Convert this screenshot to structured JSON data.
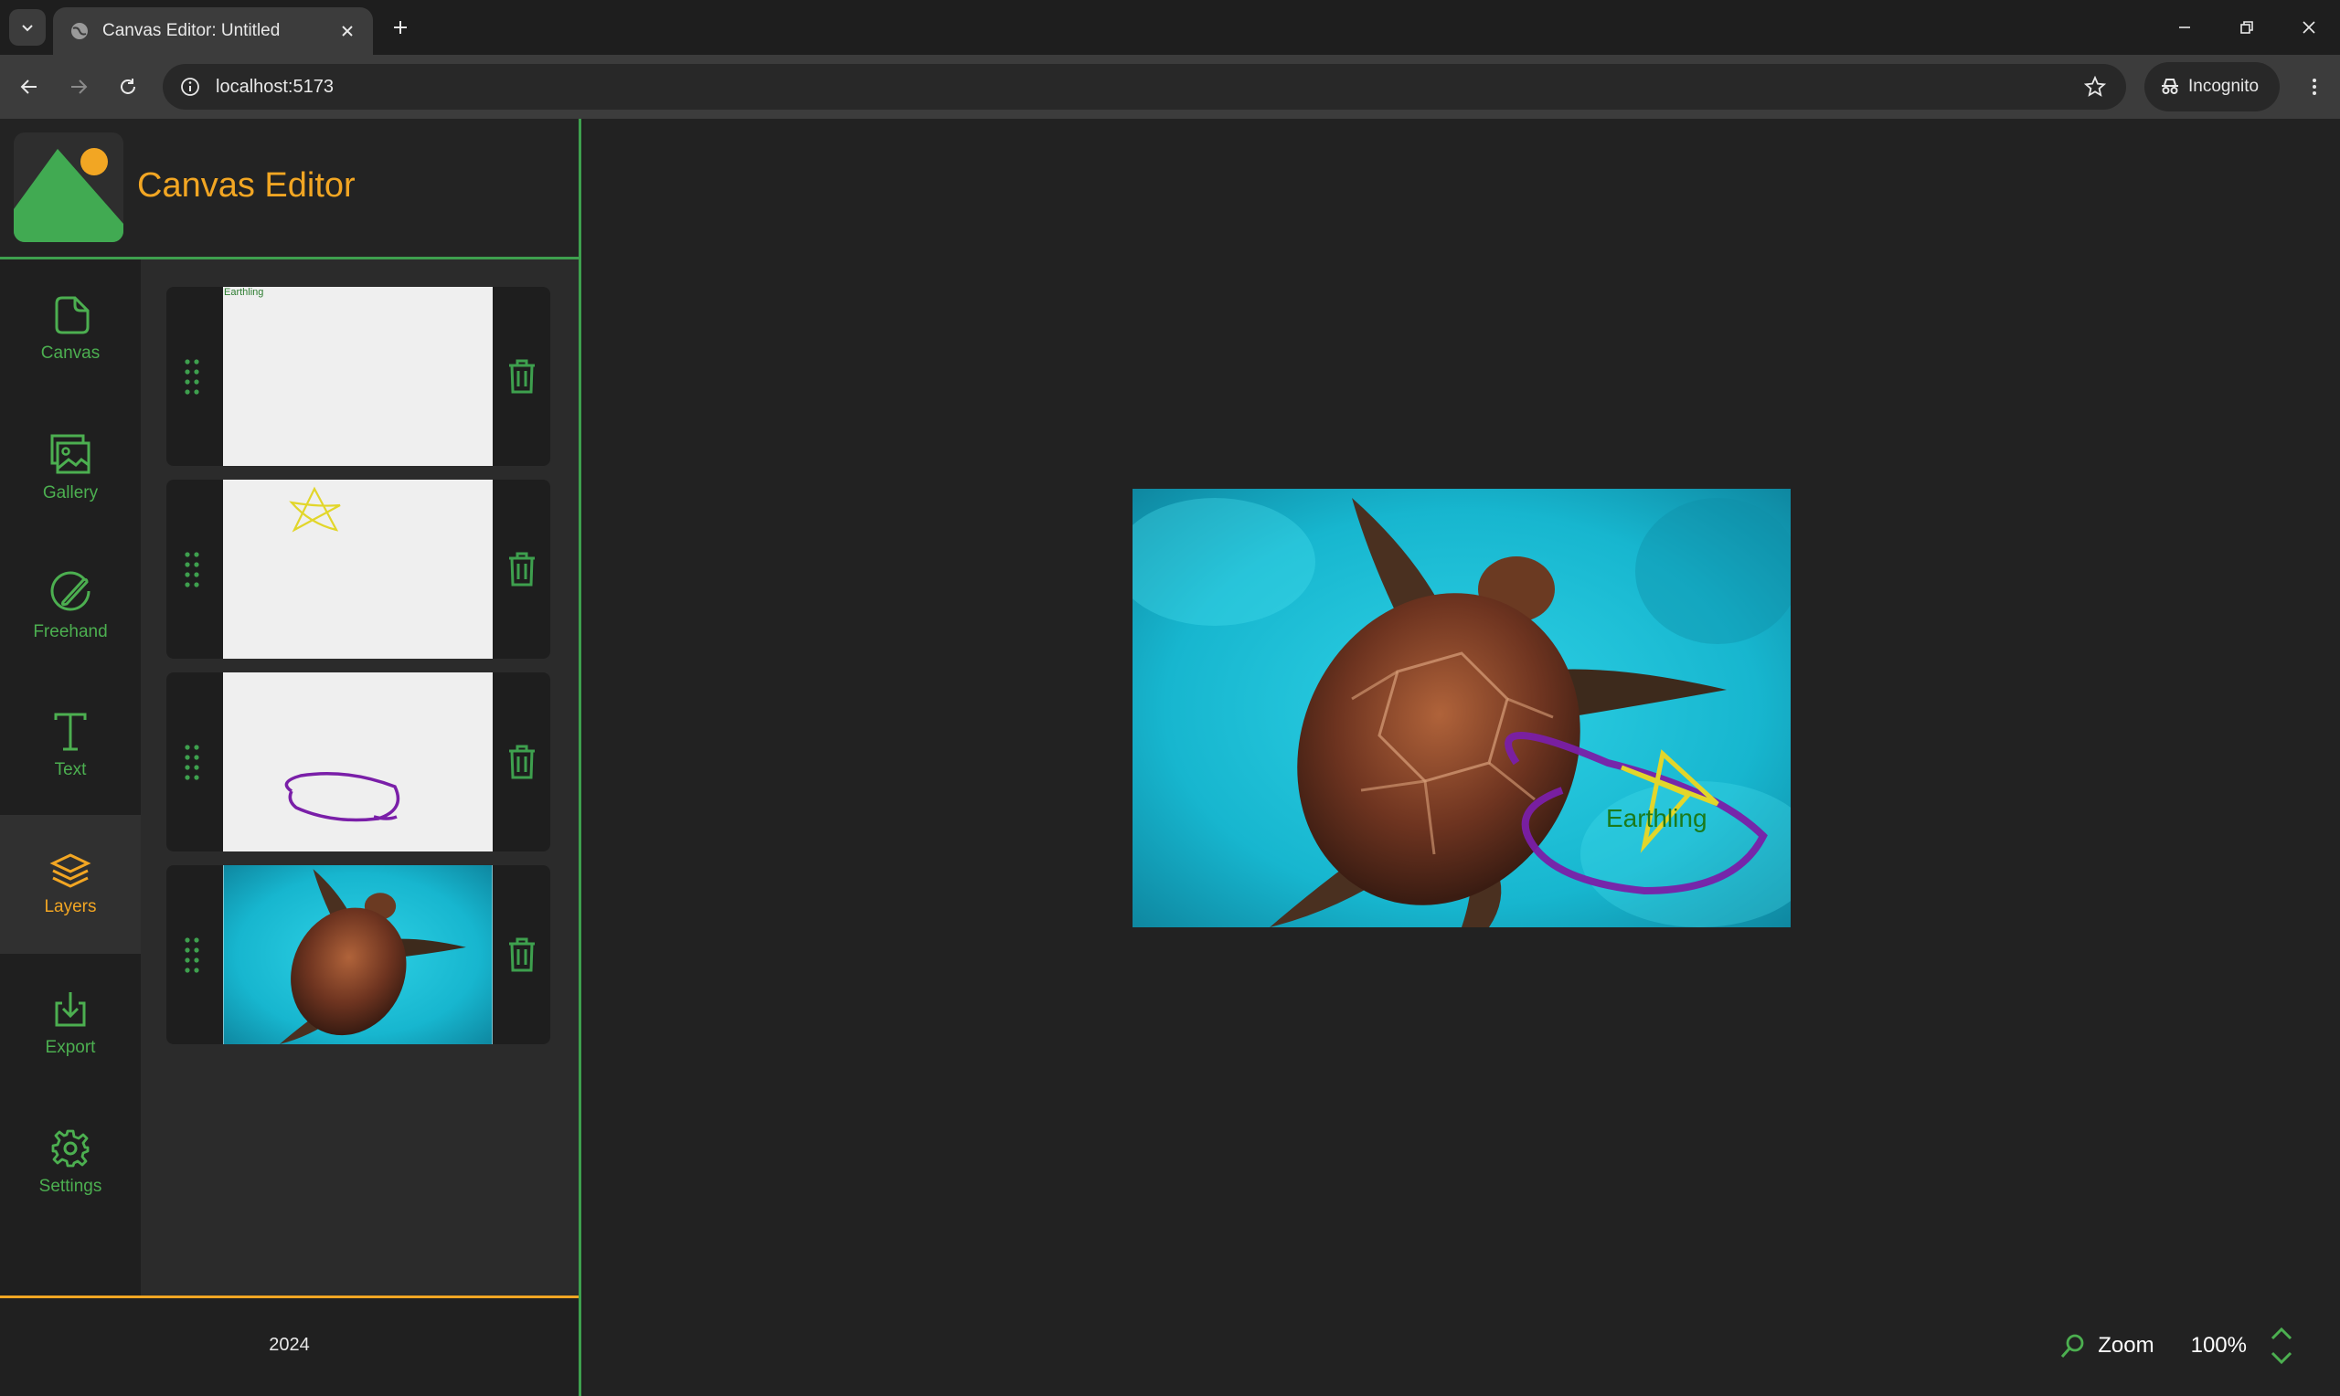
{
  "browser": {
    "tab_title": "Canvas Editor: Untitled",
    "url": "localhost:5173",
    "incognito_label": "Incognito"
  },
  "app": {
    "title": "Canvas Editor",
    "nav": [
      {
        "label": "Canvas",
        "icon": "canvas-icon"
      },
      {
        "label": "Gallery",
        "icon": "gallery-icon"
      },
      {
        "label": "Freehand",
        "icon": "freehand-icon"
      },
      {
        "label": "Text",
        "icon": "text-icon"
      },
      {
        "label": "Layers",
        "icon": "layers-icon",
        "active": true
      },
      {
        "label": "Export",
        "icon": "export-icon"
      },
      {
        "label": "Settings",
        "icon": "settings-icon"
      }
    ],
    "layers": [
      {
        "type": "text",
        "text": "Earthling"
      },
      {
        "type": "freehand-star"
      },
      {
        "type": "freehand-ellipse"
      },
      {
        "type": "image",
        "subject": "sea turtle"
      }
    ],
    "footer_year": "2024",
    "canvas_text": "Earthling",
    "zoom": {
      "label": "Zoom",
      "value": "100%"
    }
  },
  "colors": {
    "accent_green": "#3ea04e",
    "accent_orange": "#f2a623",
    "star_yellow": "#e2d62a",
    "ellipse_purple": "#7a1fa8"
  }
}
